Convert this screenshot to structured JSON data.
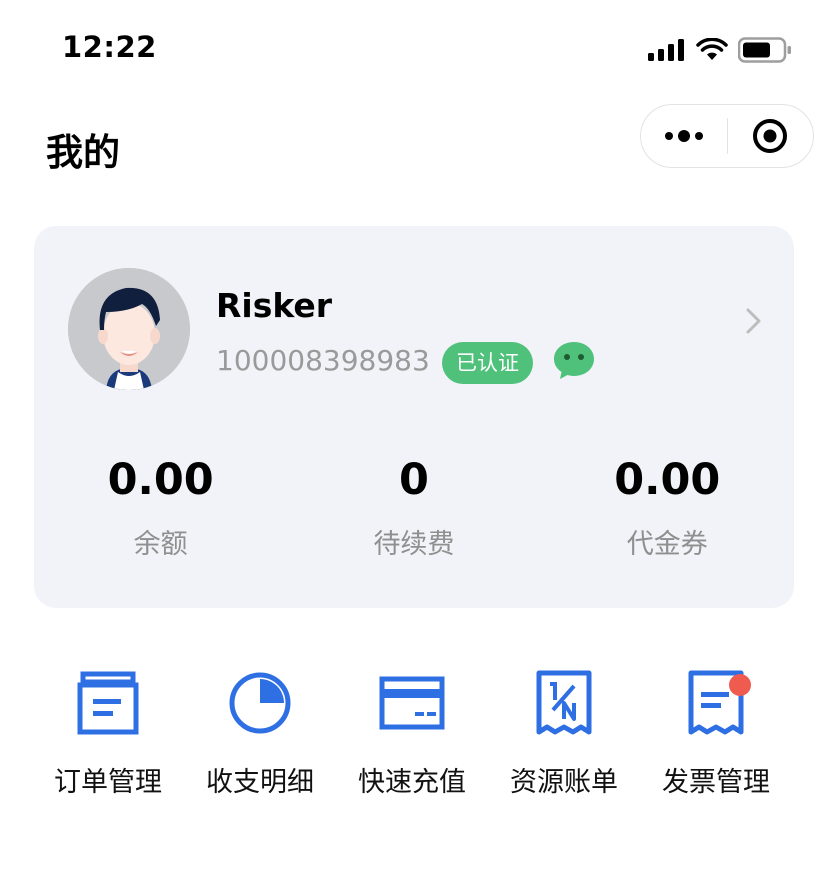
{
  "status_bar": {
    "time": "12:22"
  },
  "nav": {
    "title": "我的"
  },
  "profile": {
    "username": "Risker",
    "account_id": "100008398983",
    "verified_label": "已认证"
  },
  "stats": [
    {
      "value": "0.00",
      "label": "余额"
    },
    {
      "value": "0",
      "label": "待续费"
    },
    {
      "value": "0.00",
      "label": "代金券"
    }
  ],
  "actions": [
    {
      "label": "订单管理",
      "icon": "order-icon"
    },
    {
      "label": "收支明细",
      "icon": "pie-chart-icon"
    },
    {
      "label": "快速充值",
      "icon": "card-icon"
    },
    {
      "label": "资源账单",
      "icon": "bill-icon"
    },
    {
      "label": "发票管理",
      "icon": "invoice-icon",
      "has_notification": true
    }
  ],
  "colors": {
    "primary_blue": "#2f6fe4",
    "verified_green": "#4fc17b",
    "notification_red": "#ef5b4f",
    "card_bg": "#f2f3f8"
  }
}
